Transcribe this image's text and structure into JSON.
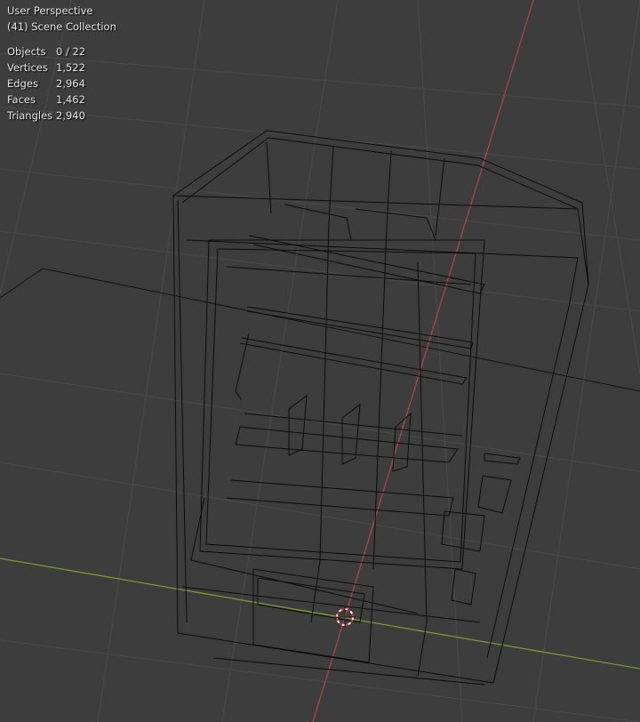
{
  "viewport": {
    "view_name": "User Perspective",
    "collection": "(41) Scene Collection",
    "stats": [
      {
        "label": "Objects",
        "value": "0 / 22"
      },
      {
        "label": "Vertices",
        "value": "1,522"
      },
      {
        "label": "Edges",
        "value": "2,964"
      },
      {
        "label": "Faces",
        "value": "1,462"
      },
      {
        "label": "Triangles",
        "value": "2,940"
      }
    ],
    "colors": {
      "background": "#3d3d3d",
      "grid": "#4d4d4d",
      "x_axis": "#7a9a2a",
      "y_axis": "#a8484f",
      "wire": "#0a0a0a"
    }
  }
}
